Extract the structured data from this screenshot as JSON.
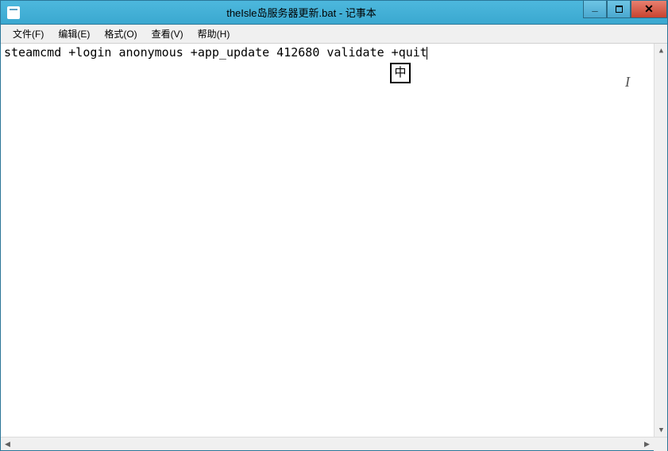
{
  "window": {
    "title": "theIsle岛服务器更新.bat - 记事本"
  },
  "menubar": {
    "file": "文件(F)",
    "edit": "编辑(E)",
    "format": "格式(O)",
    "view": "查看(V)",
    "help": "帮助(H)"
  },
  "editor": {
    "content": "steamcmd +login anonymous +app_update 412680 validate +quit"
  },
  "ime": {
    "label": "中"
  },
  "controls": {
    "min_glyph": "—",
    "max_glyph": "◻",
    "close_glyph": "✕"
  },
  "scroll": {
    "up": "▲",
    "down": "▼",
    "left": "◀",
    "right": "▶"
  }
}
